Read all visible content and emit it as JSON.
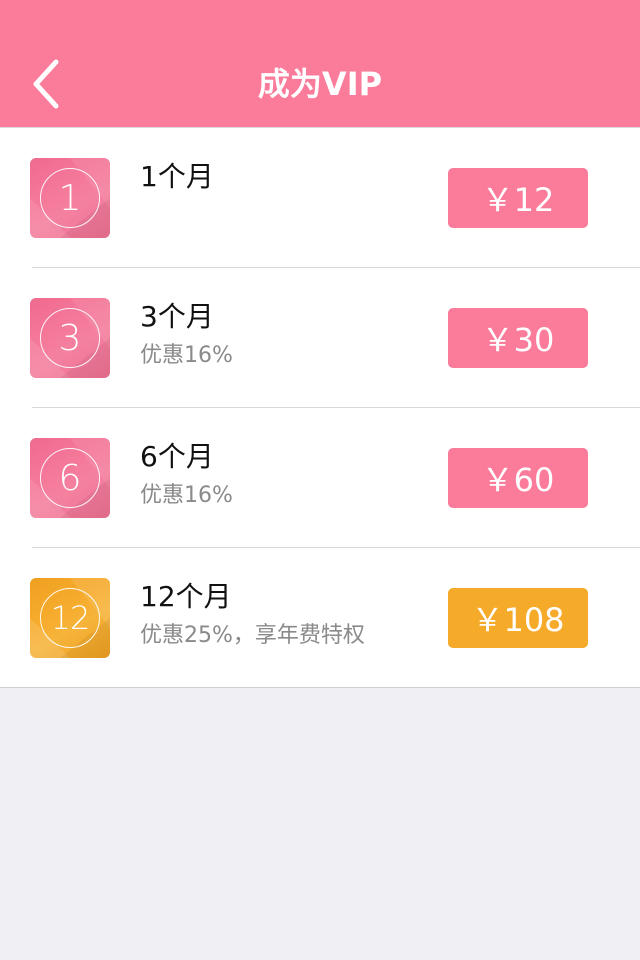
{
  "header": {
    "title": "成为VIP",
    "back_icon": "chevron-left-icon",
    "background": "#fb7b9a"
  },
  "plans": [
    {
      "badge_number": "1",
      "title": "1个月",
      "subtitle": "",
      "price": "￥12",
      "accent": "#fb7b9a"
    },
    {
      "badge_number": "3",
      "title": "3个月",
      "subtitle": "优惠16%",
      "price": "￥30",
      "accent": "#fb7b9a"
    },
    {
      "badge_number": "6",
      "title": "6个月",
      "subtitle": "优惠16%",
      "price": "￥60",
      "accent": "#fb7b9a"
    },
    {
      "badge_number": "12",
      "title": "12个月",
      "subtitle": "优惠25%，享年费特权",
      "price": "￥108",
      "accent": "#f6aa2a"
    }
  ]
}
